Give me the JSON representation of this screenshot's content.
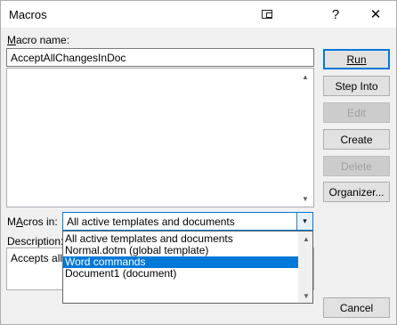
{
  "window": {
    "title": "Macros",
    "help_glyph": "?",
    "close_glyph": "✕"
  },
  "macro_name": {
    "label": "Macro name:",
    "label_ul": "M",
    "label_rest": "acro name:",
    "value": "AcceptAllChangesInDoc"
  },
  "buttons": {
    "run": "Run",
    "step_into": "Step Into",
    "edit": "Edit",
    "create": "Create",
    "delete": "Delete",
    "organizer": "Organizer...",
    "cancel": "Cancel"
  },
  "macros_in": {
    "label_ul": "A",
    "label_pre": "M",
    "label_post": "cros in:",
    "selected": "All active templates and documents",
    "options": [
      "All active templates and documents",
      "Normal.dotm (global template)",
      "Word commands",
      "Document1 (document)"
    ],
    "highlighted_index": 2
  },
  "description": {
    "label": "Description:",
    "text": "Accepts all c"
  }
}
